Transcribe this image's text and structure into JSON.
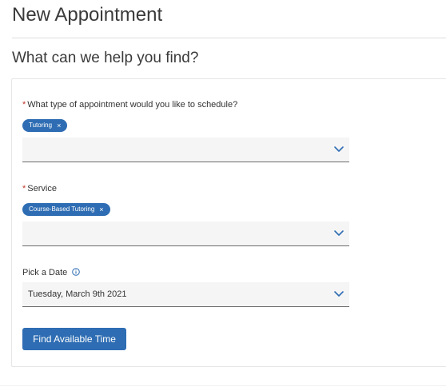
{
  "page": {
    "title": "New Appointment",
    "subtitle": "What can we help you find?"
  },
  "form": {
    "appointment_type": {
      "required_mark": "*",
      "label": "What type of appointment would you like to schedule?",
      "selected_chip": "Tutoring",
      "chip_remove": "×",
      "input_value": "",
      "icon": "chevron-down-icon"
    },
    "service": {
      "required_mark": "*",
      "label": "Service",
      "selected_chip": "Course-Based Tutoring",
      "chip_remove": "×",
      "input_value": "",
      "icon": "chevron-down-icon"
    },
    "date": {
      "label": "Pick a Date",
      "info_icon": "info-icon",
      "value": "Tuesday, March 9th 2021",
      "icon": "chevron-down-icon"
    },
    "submit_label": "Find Available Time"
  },
  "colors": {
    "accent": "#2e6db3",
    "required": "#c0392b",
    "field_bg": "#f5f5f5"
  }
}
